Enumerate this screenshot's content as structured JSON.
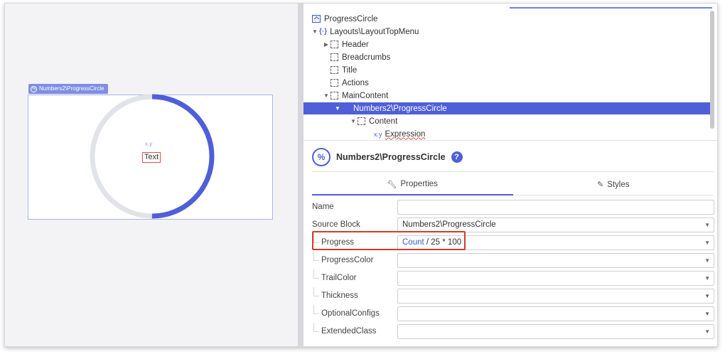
{
  "canvas": {
    "block_tag": "Numbers2\\ProgressCircle",
    "xy_label": "x.y",
    "text_widget": "Text",
    "progress_fraction": 0.5
  },
  "tree": {
    "items": [
      {
        "label": "ProgressCircle",
        "icon": "home-icon"
      },
      {
        "label": "Layouts\\LayoutTopMenu",
        "icon": "braces-icon"
      },
      {
        "label": "Header",
        "icon": "placeholder-icon"
      },
      {
        "label": "Breadcrumbs",
        "icon": "placeholder-icon"
      },
      {
        "label": "Title",
        "icon": "placeholder-icon"
      },
      {
        "label": "Actions",
        "icon": "placeholder-icon"
      },
      {
        "label": "MainContent",
        "icon": "placeholder-icon"
      },
      {
        "label": "Numbers2\\ProgressCircle",
        "icon": "none"
      },
      {
        "label": "Content",
        "icon": "placeholder-icon"
      },
      {
        "label": "Expression",
        "icon": "xy-icon"
      }
    ],
    "xy_prefix": "x.y"
  },
  "properties_panel": {
    "title": "Numbers2\\ProgressCircle",
    "icon_glyph": "%",
    "help_glyph": "?",
    "tabs": [
      {
        "label": "Properties",
        "icon": "wrench-icon"
      },
      {
        "label": "Styles",
        "icon": "brush-icon"
      }
    ],
    "rows": [
      {
        "label": "Name",
        "value": ""
      },
      {
        "label": "Source Block",
        "value": "Numbers2\\ProgressCircle"
      },
      {
        "label": "Progress",
        "value_parts": [
          "Count",
          " / 25 * 100"
        ]
      },
      {
        "label": "ProgressColor",
        "value": ""
      },
      {
        "label": "TrailColor",
        "value": ""
      },
      {
        "label": "Thickness",
        "value": ""
      },
      {
        "label": "OptionalConfigs",
        "value": ""
      },
      {
        "label": "ExtendedClass",
        "value": ""
      }
    ]
  },
  "colors": {
    "accent": "#4f5fd8",
    "trail": "#e2e3e8",
    "highlight": "#d23b2a"
  }
}
